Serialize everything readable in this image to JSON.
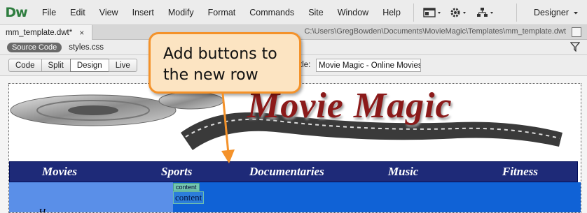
{
  "app": {
    "logo": "Dw"
  },
  "menu": [
    "File",
    "Edit",
    "View",
    "Insert",
    "Modify",
    "Format",
    "Commands",
    "Site",
    "Window",
    "Help"
  ],
  "toolbar_icons": [
    "layout-icon",
    "gear-icon",
    "sitemap-icon"
  ],
  "workspace": {
    "label": "Designer"
  },
  "document": {
    "tab_label": "mm_template.dwt*",
    "close_glyph": "×",
    "path": "C:\\Users\\GregBowden\\Documents\\MovieMagic\\Templates\\mm_template.dwt"
  },
  "related_files": {
    "source_code": "Source Code",
    "files": [
      "styles.css"
    ]
  },
  "view_buttons": [
    "Code",
    "Split",
    "Design",
    "Live"
  ],
  "active_view": "Design",
  "page_title": {
    "label": "tle:",
    "value": "Movie Magic - Online Movies"
  },
  "canvas": {
    "banner_title": "Movie Magic",
    "nav": [
      "Movies",
      "Sports",
      "Documentaries",
      "Music",
      "Fitness"
    ],
    "editable_tag": "content",
    "editable_text": "content",
    "left_text": "H"
  },
  "callout": {
    "line1": "Add buttons to",
    "line2": "the new row"
  },
  "colors": {
    "nav_bg": "#1e2a78",
    "content_bg": "#1062d6",
    "left_col_bg": "#5a8fe8",
    "callout_border": "#f4922a",
    "callout_bg": "#fce4c2",
    "banner_title": "#8b1a1a"
  }
}
